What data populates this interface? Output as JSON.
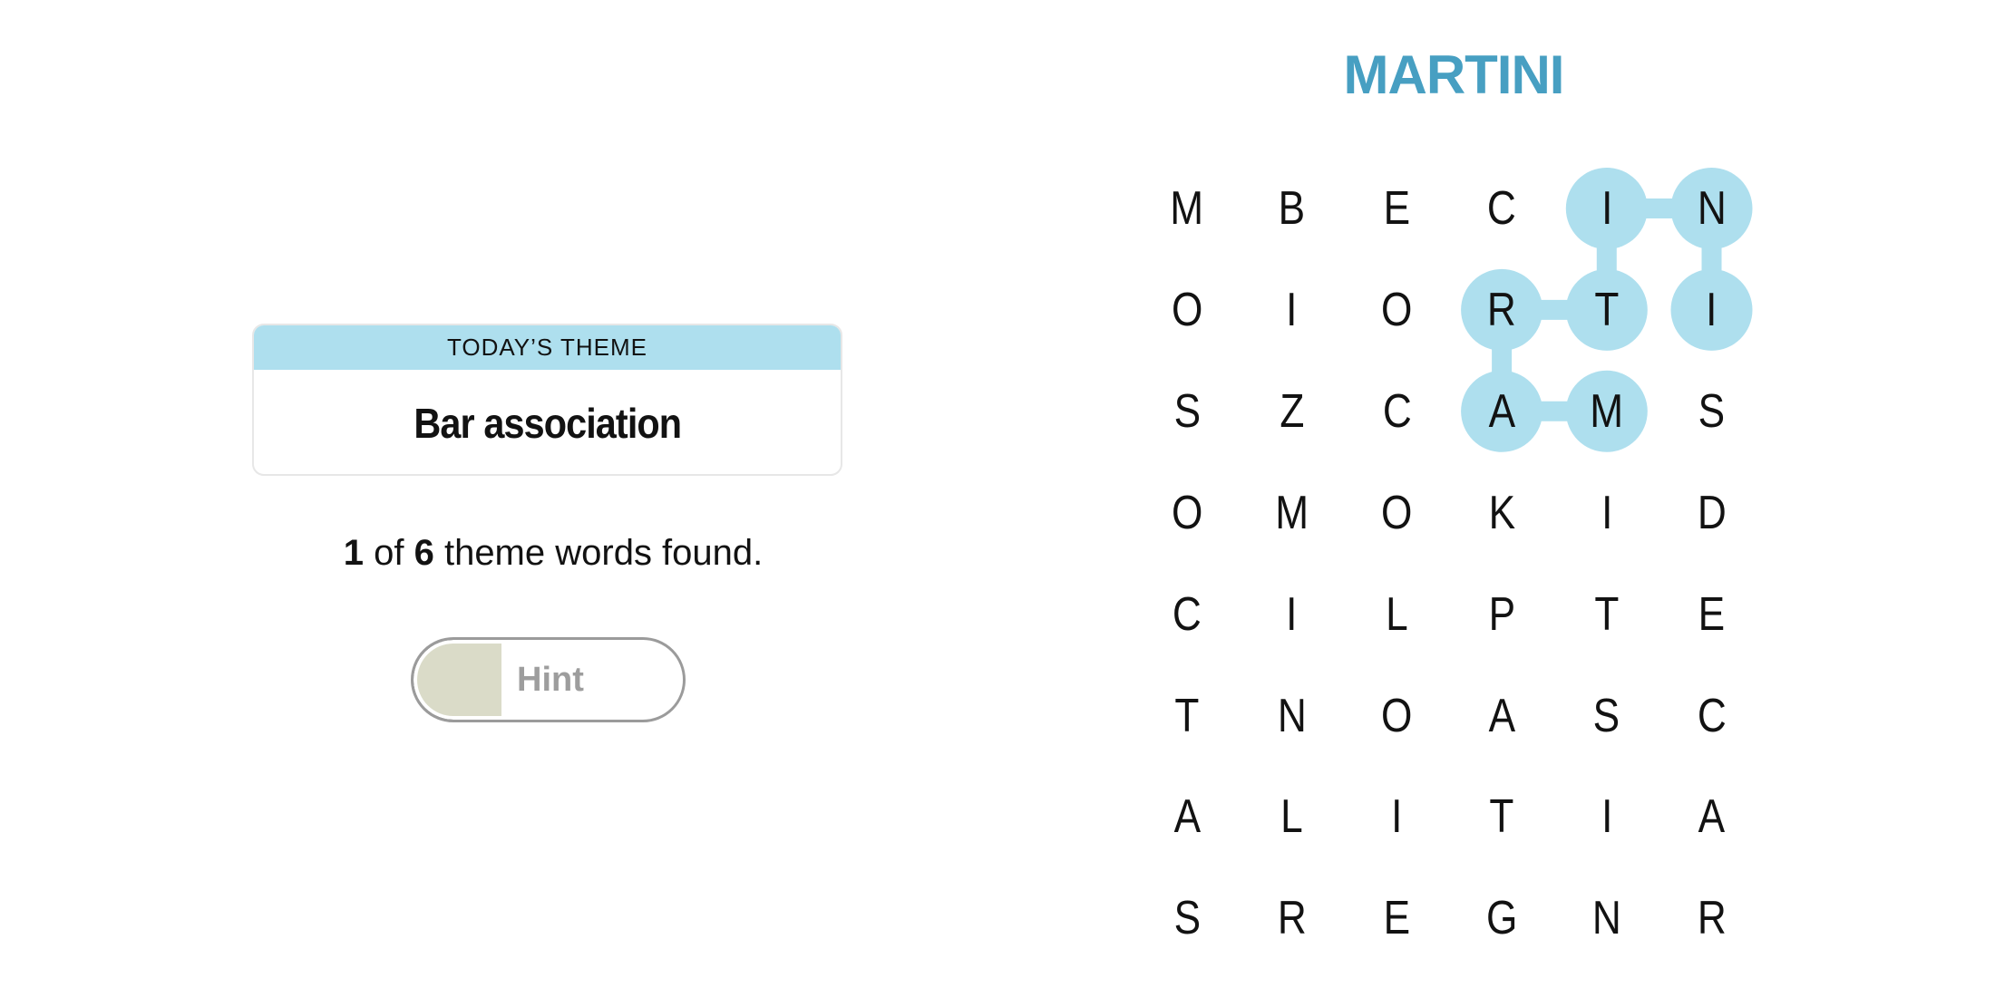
{
  "theme_card": {
    "header": "TODAY’S THEME",
    "title": "Bar association"
  },
  "progress": {
    "found": "1",
    "of_label": "of",
    "total": "6",
    "suffix": "theme words found."
  },
  "hint": {
    "label": "Hint",
    "progress_fraction": 0.33
  },
  "current_word": "MARTINI",
  "colors": {
    "highlight": "#aedfee",
    "current_word": "#479fc2",
    "hint_fill": "#dadbc8"
  },
  "board": {
    "rows": [
      [
        "M",
        "B",
        "E",
        "C",
        "I",
        "N"
      ],
      [
        "O",
        "I",
        "O",
        "R",
        "T",
        "I"
      ],
      [
        "S",
        "Z",
        "C",
        "A",
        "M",
        "S"
      ],
      [
        "O",
        "M",
        "O",
        "K",
        "I",
        "D"
      ],
      [
        "C",
        "I",
        "L",
        "P",
        "T",
        "E"
      ],
      [
        "T",
        "N",
        "O",
        "A",
        "S",
        "C"
      ],
      [
        "A",
        "L",
        "I",
        "T",
        "I",
        "A"
      ],
      [
        "S",
        "R",
        "E",
        "G",
        "N",
        "R"
      ]
    ],
    "selected_path": [
      [
        2,
        4
      ],
      [
        2,
        3
      ],
      [
        1,
        3
      ],
      [
        1,
        4
      ],
      [
        0,
        4
      ],
      [
        0,
        5
      ],
      [
        1,
        5
      ]
    ]
  }
}
